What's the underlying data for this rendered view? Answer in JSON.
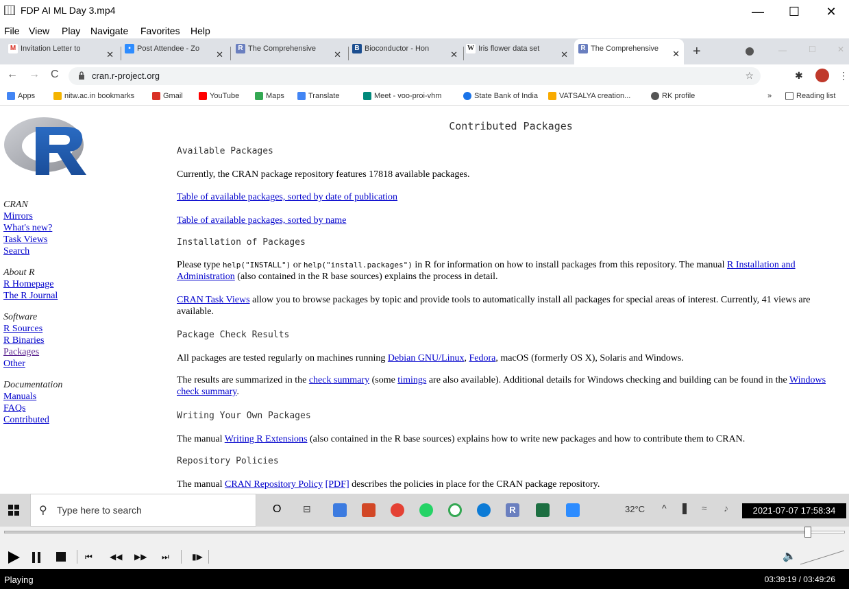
{
  "window": {
    "title": "FDP AI ML Day 3.mp4",
    "minimize": "—",
    "maximize": "☐",
    "close": "✕"
  },
  "menu": [
    "File",
    "View",
    "Play",
    "Navigate",
    "Favorites",
    "Help"
  ],
  "tabs": [
    {
      "label": "Invitation Letter to",
      "color": "#d93025",
      "glyph": "M"
    },
    {
      "label": "Post Attendee - Zo",
      "color": "#2d8cff",
      "glyph": "▢"
    },
    {
      "label": "The Comprehensive",
      "color": "#6a7fbf",
      "glyph": "R"
    },
    {
      "label": "Bioconductor - Hon",
      "color": "#1a4d8f",
      "glyph": "B"
    },
    {
      "label": "Iris flower data set",
      "color": "#444",
      "glyph": "W"
    },
    {
      "label": "The Comprehensive",
      "color": "#6a7fbf",
      "glyph": "R"
    }
  ],
  "address": {
    "url": "cran.r-project.org"
  },
  "bookmarks": [
    {
      "label": "Apps",
      "color": "#4285f4"
    },
    {
      "label": "nitw.ac.in bookmarks",
      "color": "#f4b400"
    },
    {
      "label": "Gmail",
      "color": "#d93025"
    },
    {
      "label": "YouTube",
      "color": "#ff0000"
    },
    {
      "label": "Maps",
      "color": "#34a853"
    },
    {
      "label": "Translate",
      "color": "#4285f4"
    },
    {
      "label": "Meet - voo-proi-vhm",
      "color": "#00897b"
    },
    {
      "label": "State Bank of India",
      "color": "#1a73e8"
    },
    {
      "label": "VATSALYA creation...",
      "color": "#f9ab00"
    },
    {
      "label": "RK profile",
      "color": "#555"
    }
  ],
  "bookmarks_more": "»",
  "reading_list": "Reading list",
  "sidebar": {
    "cran_header": "CRAN",
    "cran_links": [
      "Mirrors",
      "What's new?",
      "Task Views",
      "Search"
    ],
    "about_header": "About R",
    "about_links": [
      "R Homepage",
      "The R Journal"
    ],
    "software_header": "Software",
    "software_links": [
      "R Sources",
      "R Binaries",
      "Packages",
      "Other"
    ],
    "docs_header": "Documentation",
    "docs_links": [
      "Manuals",
      "FAQs",
      "Contributed"
    ]
  },
  "main": {
    "title": "Contributed Packages",
    "h_available": "Available Packages",
    "p_currently": "Currently, the CRAN package repository features 17818 available packages.",
    "link_by_date": "Table of available packages, sorted by date of publication",
    "link_by_name": "Table of available packages, sorted by name",
    "h_install": "Installation of Packages",
    "p_install_a": "Please type ",
    "code_install": "help(\"INSTALL\")",
    "p_install_b": " or ",
    "code_install_packages": "help(\"install.packages\")",
    "p_install_c": " in R for information on how to install packages from this repository. The manual ",
    "link_r_install": "R Installation and Administration",
    "p_install_d": " (also contained in the R base sources) explains the process in detail.",
    "link_task_views": "CRAN Task Views",
    "p_taskviews": " allow you to browse packages by topic and provide tools to automatically install all packages for special areas of interest. Currently, 41 views are available.",
    "h_check": "Package Check Results",
    "p_check_a": "All packages are tested regularly on machines running ",
    "link_debian": "Debian GNU/Linux",
    "p_check_b": ", ",
    "link_fedora": "Fedora",
    "p_check_c": ", macOS (formerly OS X), Solaris and Windows.",
    "p_results_a": "The results are summarized in the ",
    "link_check_summary": "check summary",
    "p_results_b": " (some ",
    "link_timings": "timings",
    "p_results_c": " are also available). Additional details for Windows checking and building can be found in the ",
    "link_windows_summary": "Windows check summary",
    "p_results_d": ".",
    "h_writing": "Writing Your Own Packages",
    "p_writing_a": "The manual ",
    "link_writing": "Writing R Extensions",
    "p_writing_b": " (also contained in the R base sources) explains how to write new packages and how to contribute them to CRAN.",
    "h_policies": "Repository Policies",
    "p_policy_a": "The manual ",
    "link_policy": "CRAN Repository Policy",
    "link_pdf": "[PDF]",
    "p_policy_b": " describes the policies in place for the CRAN package repository."
  },
  "taskbar": {
    "search_placeholder": "Type here to search",
    "weather": "32°C",
    "clock": "2021-07-07 17:58:34"
  },
  "player": {
    "status": "Playing",
    "time": "03:39:19 / 03:49:26",
    "progress": 0.956
  }
}
